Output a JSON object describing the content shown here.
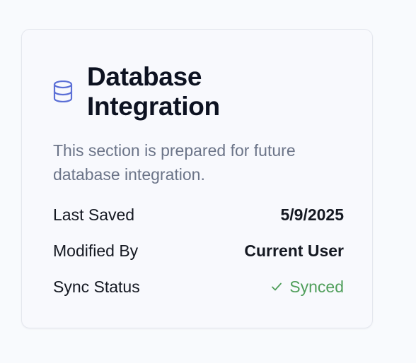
{
  "card": {
    "title": "Database Integration",
    "description": "This section is prepared for future database integration.",
    "icon": "database-icon",
    "accent_color": "#5b6fd6"
  },
  "details": [
    {
      "label": "Last Saved",
      "value": "5/9/2025"
    },
    {
      "label": "Modified By",
      "value": "Current User"
    },
    {
      "label": "Sync Status",
      "value": "Synced",
      "icon": "check-icon",
      "color": "#4f9e5a"
    }
  ]
}
